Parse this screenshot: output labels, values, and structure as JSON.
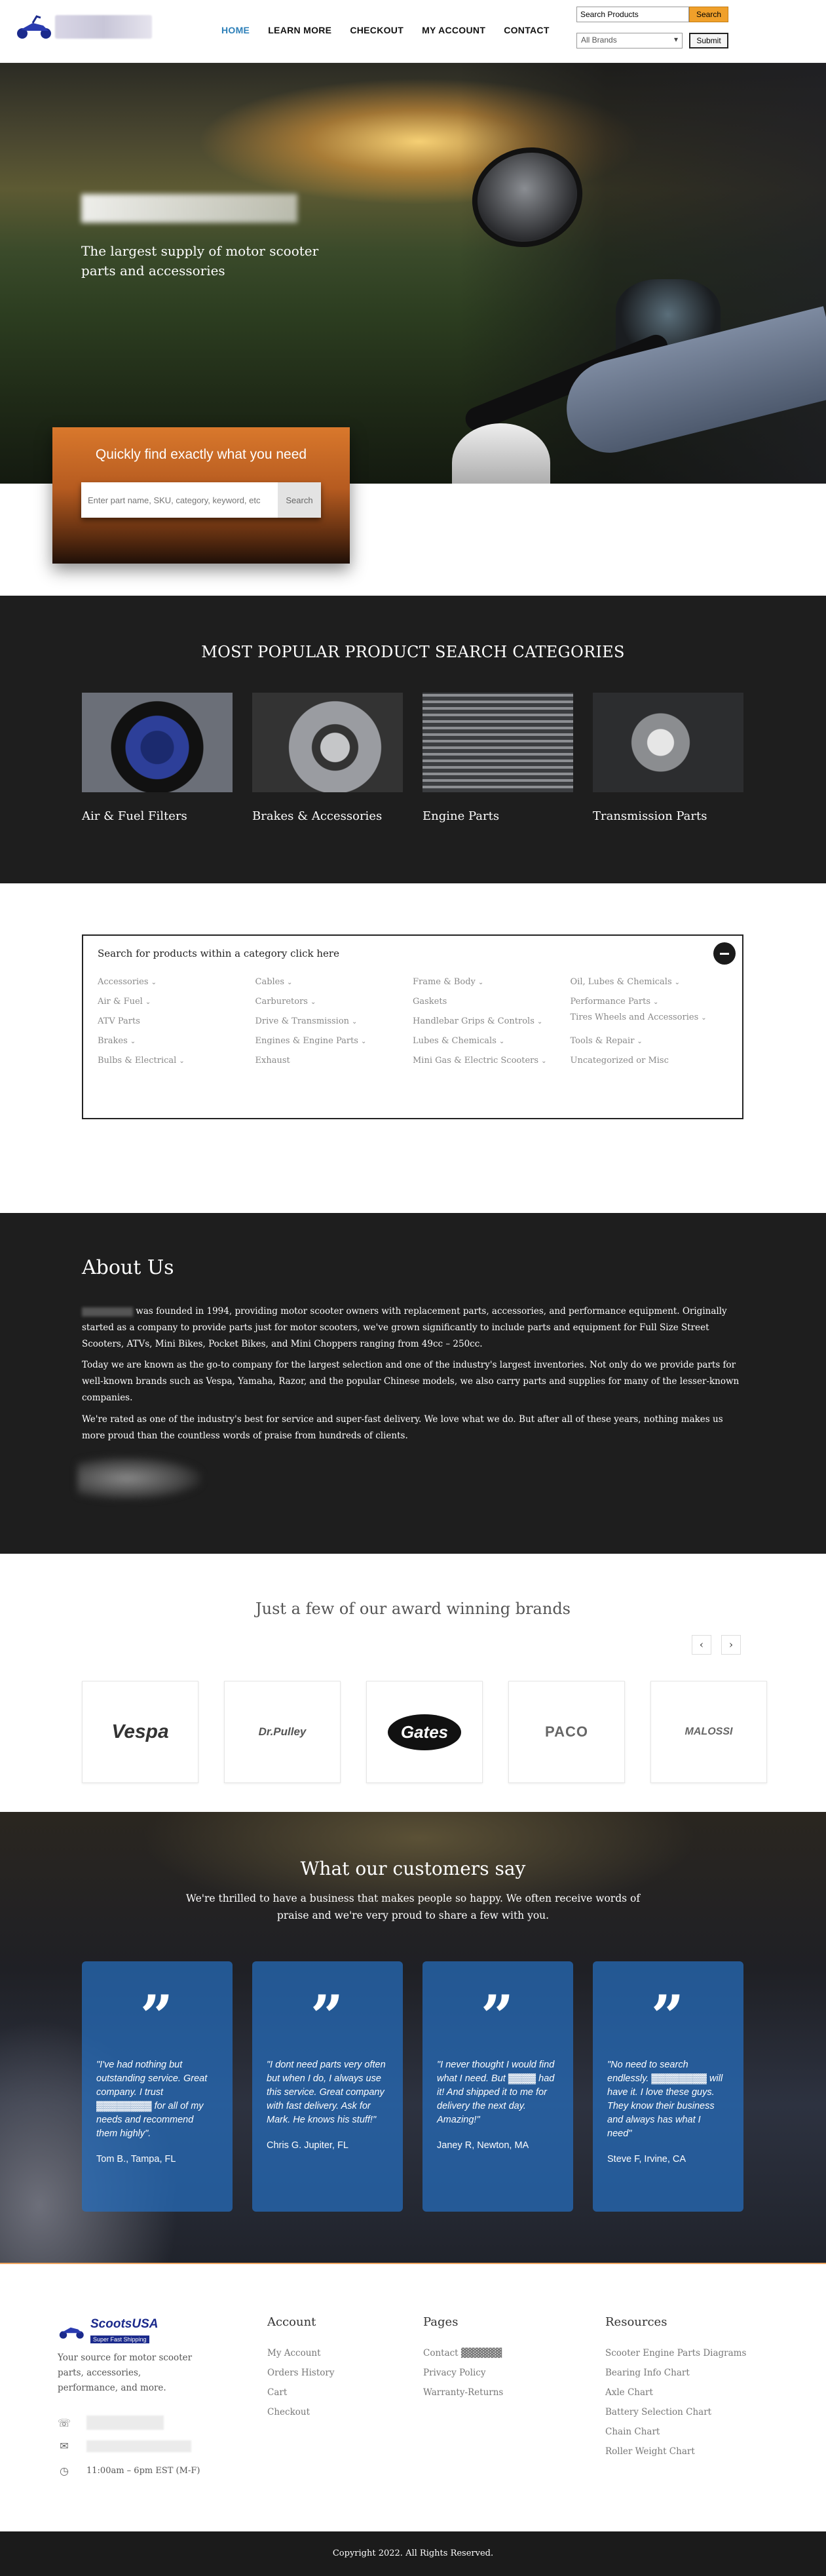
{
  "header": {
    "nav": [
      "HOME",
      "LEARN MORE",
      "CHECKOUT",
      "MY ACCOUNT",
      "CONTACT"
    ],
    "search_value": "Search Products",
    "search_button": "Search",
    "brand_select": "All Brands",
    "submit_button": "Submit"
  },
  "hero": {
    "tagline": "The largest supply of motor scooter parts and accessories",
    "quickfind_title": "Quickly find exactly what you need",
    "quickfind_placeholder": "Enter part name, SKU, category, keyword, etc",
    "quickfind_button": "Search"
  },
  "categories": {
    "title": "MOST POPULAR PRODUCT SEARCH CATEGORIES",
    "items": [
      "Air & Fuel Filters",
      "Brakes & Accessories",
      "Engine Parts",
      "Transmission Parts"
    ]
  },
  "catlist": {
    "title": "Search for products within a category click here",
    "cols": [
      [
        "Accessories",
        "Air & Fuel",
        "ATV Parts",
        "Brakes",
        "Bulbs & Electrical"
      ],
      [
        "Cables",
        "Carburetors",
        "Drive & Transmission",
        "Engines & Engine Parts",
        "Exhaust"
      ],
      [
        "Frame & Body",
        "Gaskets",
        "Handlebar Grips & Controls",
        "Lubes & Chemicals",
        "Mini Gas & Electric Scooters"
      ],
      [
        "Oil, Lubes & Chemicals",
        "Performance Parts",
        "Tires Wheels and Accessories",
        "Tools & Repair",
        "Uncategorized or Misc"
      ]
    ]
  },
  "about": {
    "title": "About Us",
    "p1": "was founded in 1994, providing motor scooter owners with replacement parts, accessories, and performance equipment.  Originally started as a company to provide parts just for motor scooters, we've grown significantly to include parts and equipment for Full Size Street Scooters, ATVs, Mini Bikes, Pocket Bikes, and Mini Choppers ranging from 49cc – 250cc.",
    "p2": "Today we are known as the go-to company for the largest selection and one of the industry's largest inventories.  Not only do we provide parts for well-known brands such as Vespa, Yamaha, Razor, and the popular Chinese models, we also carry parts and supplies for many of the lesser-known companies.",
    "p3": "We're rated as one of the industry's best for service and super-fast delivery.  We love what we do.  But after all of these years, nothing makes us more proud than the countless words of praise from hundreds of clients."
  },
  "brands": {
    "title": "Just a few of our award winning brands",
    "logos": [
      "Vespa",
      "Dr.Pulley",
      "Gates",
      "PACO",
      "MALOSSI"
    ]
  },
  "testimonials": {
    "title": "What our customers say",
    "intro": "We're thrilled to have a business that makes people so happy.  We often receive words of praise and we're very proud to share a few with you.",
    "quote_mark": "”",
    "cards": [
      {
        "text": "\"I've had nothing but outstanding service.  Great company.  I trust ▓▓▓▓▓▓▓▓ for all of my needs and recommend them highly\".",
        "who": "Tom B., Tampa, FL"
      },
      {
        "text": "\"I dont need parts very often but when I do, I always use this service.  Great company with fast delivery.  Ask for Mark.  He knows his stuff!\"",
        "who": "Chris G. Jupiter, FL"
      },
      {
        "text": "\"I never thought I would find what I need.  But ▓▓▓▓ had it!  And shipped it to me for delivery the next day.  Amazing!\"",
        "who": "Janey R, Newton, MA"
      },
      {
        "text": "\"No need to search endlessly.  ▓▓▓▓▓▓▓▓ will have it.  I love these guys.  They know their business and always has what I need\"",
        "who": "Steve F, Irvine, CA"
      }
    ]
  },
  "footer": {
    "logo_text": "ScootsUSA",
    "logo_tagline": "Super Fast Shipping",
    "description": "Your source for motor scooter parts, accessories, performance, and more.",
    "hours": "11:00am – 6pm EST (M-F)",
    "account_title": "Account",
    "account_links": [
      "My Account",
      "Orders History",
      "Cart",
      "Checkout"
    ],
    "pages_title": "Pages",
    "pages_links": [
      "Contact ▓▓▓▓▓▓",
      "Privacy Policy",
      "Warranty-Returns"
    ],
    "resources_title": "Resources",
    "resources_links": [
      "Scooter Engine Parts Diagrams",
      "Bearing Info Chart",
      "Axle Chart",
      "Battery Selection Chart",
      "Chain Chart",
      "Roller Weight Chart"
    ],
    "copyright": "Copyright 2022.  All Rights Reserved."
  }
}
